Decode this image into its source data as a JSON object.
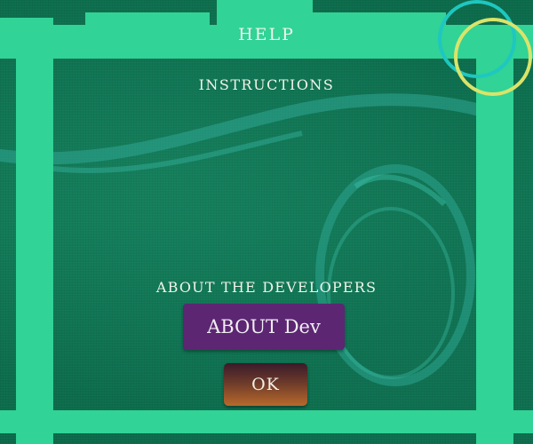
{
  "dialog": {
    "title": "HELP",
    "instructions_label": "INSTRUCTIONS",
    "about_heading": "ABOUT THE DEVELOPERS",
    "about_button_label": "ABOUT Dev",
    "ok_button_label": "OK"
  },
  "colors": {
    "frame": "#31d396",
    "background": "#0e6a4c",
    "about_button": "#5c2673",
    "ok_button_top": "#3a1a2a",
    "ok_button_bottom": "#b8692c",
    "ring_teal": "#1ec7c0",
    "ring_yellow": "#d9e46a"
  },
  "icons": {
    "corner_decoration": "overlapping-rings-icon"
  }
}
